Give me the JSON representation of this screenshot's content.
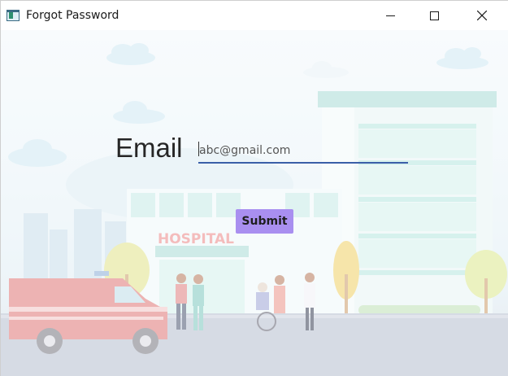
{
  "window": {
    "title": "Forgot Password"
  },
  "form": {
    "email_label": "Email",
    "email_value": "abc@gmail.com",
    "submit_label": "Submit"
  },
  "illustration": {
    "sign_text": "HOSPITAL"
  },
  "colors": {
    "submit_bg": "#a98ff0",
    "input_underline": "#3a5fa8"
  }
}
